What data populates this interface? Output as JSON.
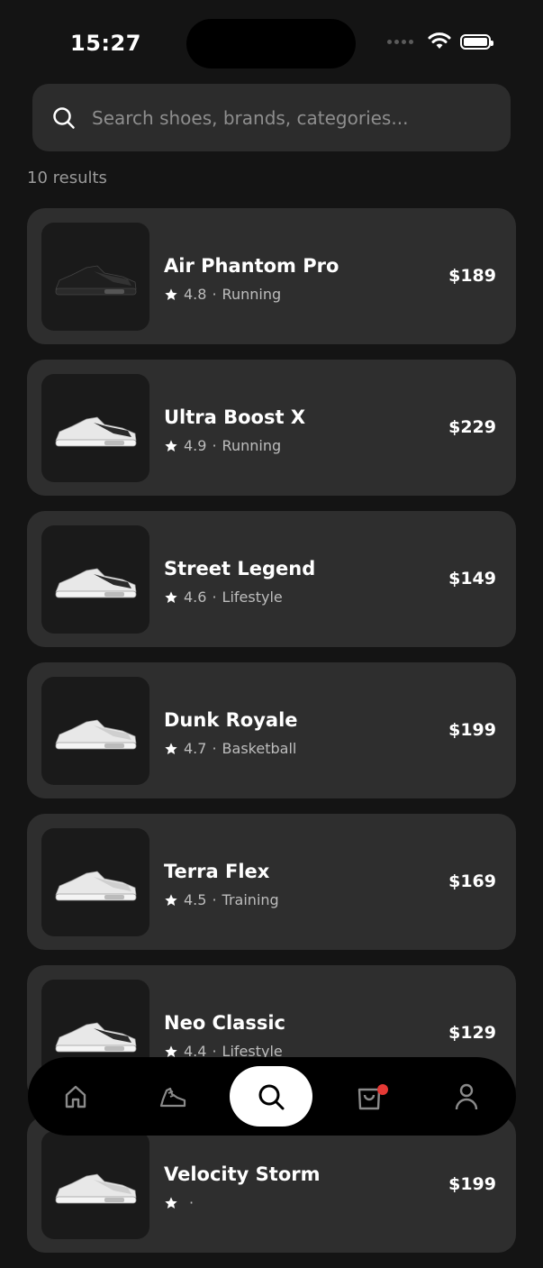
{
  "status_bar": {
    "time": "15:27"
  },
  "search": {
    "placeholder": "Search shoes, brands, categories..."
  },
  "results_count": "10 results",
  "products": [
    {
      "name": "Air Phantom Pro",
      "rating": "4.8",
      "category": "Running",
      "price": "$189",
      "shoe_color": "black"
    },
    {
      "name": "Ultra Boost X",
      "rating": "4.9",
      "category": "Running",
      "price": "$229",
      "shoe_color": "white-black"
    },
    {
      "name": "Street Legend",
      "rating": "4.6",
      "category": "Lifestyle",
      "price": "$149",
      "shoe_color": "white-black"
    },
    {
      "name": "Dunk Royale",
      "rating": "4.7",
      "category": "Basketball",
      "price": "$199",
      "shoe_color": "white"
    },
    {
      "name": "Terra Flex",
      "rating": "4.5",
      "category": "Training",
      "price": "$169",
      "shoe_color": "white"
    },
    {
      "name": "Neo Classic",
      "rating": "4.4",
      "category": "Lifestyle",
      "price": "$129",
      "shoe_color": "white-black"
    },
    {
      "name": "Velocity Storm",
      "rating": "",
      "category": "",
      "price": "$199",
      "shoe_color": "white"
    }
  ],
  "bottom_nav": {
    "items": [
      {
        "icon": "home-icon"
      },
      {
        "icon": "shoe-icon"
      },
      {
        "icon": "search-icon",
        "active": true
      },
      {
        "icon": "bag-icon",
        "badge": true
      },
      {
        "icon": "profile-icon"
      }
    ]
  },
  "colors": {
    "badge": "#e53935",
    "card": "#2e2e2e",
    "background": "#141414"
  }
}
